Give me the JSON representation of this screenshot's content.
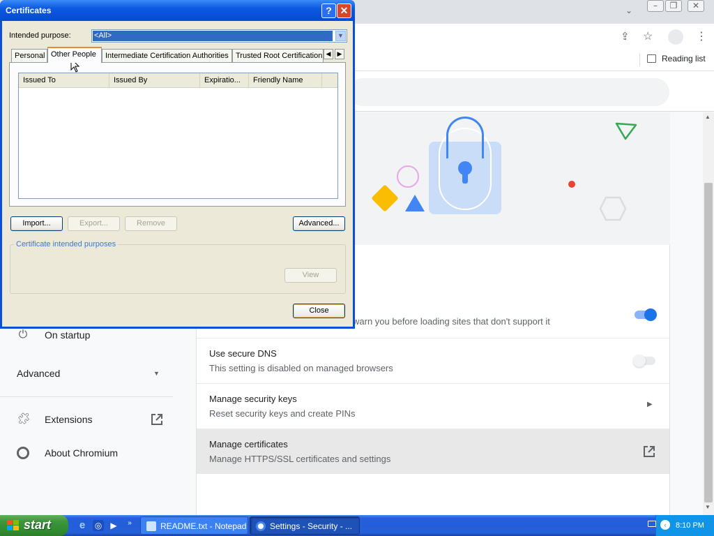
{
  "browser": {
    "reading_list": "Reading list",
    "rows": [
      {
        "t1": "",
        "t2": "warn you before loading sites that don't support it",
        "toggle": "on"
      },
      {
        "t1": "Use secure DNS",
        "t2": "This setting is disabled on managed browsers",
        "toggle": "off"
      },
      {
        "t1": "Manage security keys",
        "t2": "Reset security keys and create PINs"
      },
      {
        "t1": "Manage certificates",
        "t2": "Manage HTTPS/SSL certificates and settings"
      }
    ],
    "sidebar": {
      "on_startup": "On startup",
      "advanced": "Advanced",
      "extensions": "Extensions",
      "about": "About Chromium"
    }
  },
  "dialog": {
    "title": "Certificates",
    "help_glyph": "?",
    "close_glyph": "✕",
    "purpose_label": "Intended purpose:",
    "purpose_value": "<All>",
    "tabs": [
      "Personal",
      "Other People",
      "Intermediate Certification Authorities",
      "Trusted Root Certification"
    ],
    "active_tab": "Other People",
    "columns": [
      "Issued To",
      "Issued By",
      "Expiratio...",
      "Friendly Name"
    ],
    "buttons": {
      "import": "Import...",
      "export": "Export...",
      "remove": "Remove",
      "advanced": "Advanced...",
      "view": "View",
      "close": "Close"
    },
    "group_label": "Certificate intended purposes"
  },
  "taskbar": {
    "start": "start",
    "tasks": [
      "README.txt - Notepad",
      "Settings - Security - ..."
    ],
    "clock": "8:10 PM"
  }
}
